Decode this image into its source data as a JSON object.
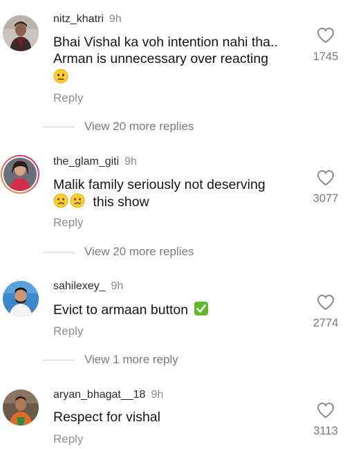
{
  "comments": [
    {
      "username": "nitz_khatri",
      "time": "9h",
      "line1": "Bhai Vishal ka voh intention nahi tha..",
      "line2": "Arman is unnecessary over reacting",
      "emoji": "neutral-face",
      "reply": "Reply",
      "likes": "1745",
      "view_more": "View 20 more replies"
    },
    {
      "username": "the_glam_giti",
      "time": "9h",
      "line1": "Malik family seriously not deserving",
      "line2": "this show",
      "emoji": "crying-face",
      "reply": "Reply",
      "likes": "3077",
      "view_more": "View 20 more replies"
    },
    {
      "username": "sahilexey_",
      "time": "9h",
      "line1": "Evict to armaan button",
      "emoji": "check-mark-button",
      "reply": "Reply",
      "likes": "2774",
      "view_more": "View 1 more reply"
    },
    {
      "username": "aryan_bhagat__18",
      "time": "9h",
      "line1": "Respect for vishal",
      "reply": "Reply",
      "likes": "3113"
    }
  ],
  "colors": {
    "text": "#151515",
    "secondary": "#8e8e8e",
    "story_ring_start": "#f9a33c",
    "story_ring_end": "#c9177e",
    "check_green": "#5fb82e"
  }
}
